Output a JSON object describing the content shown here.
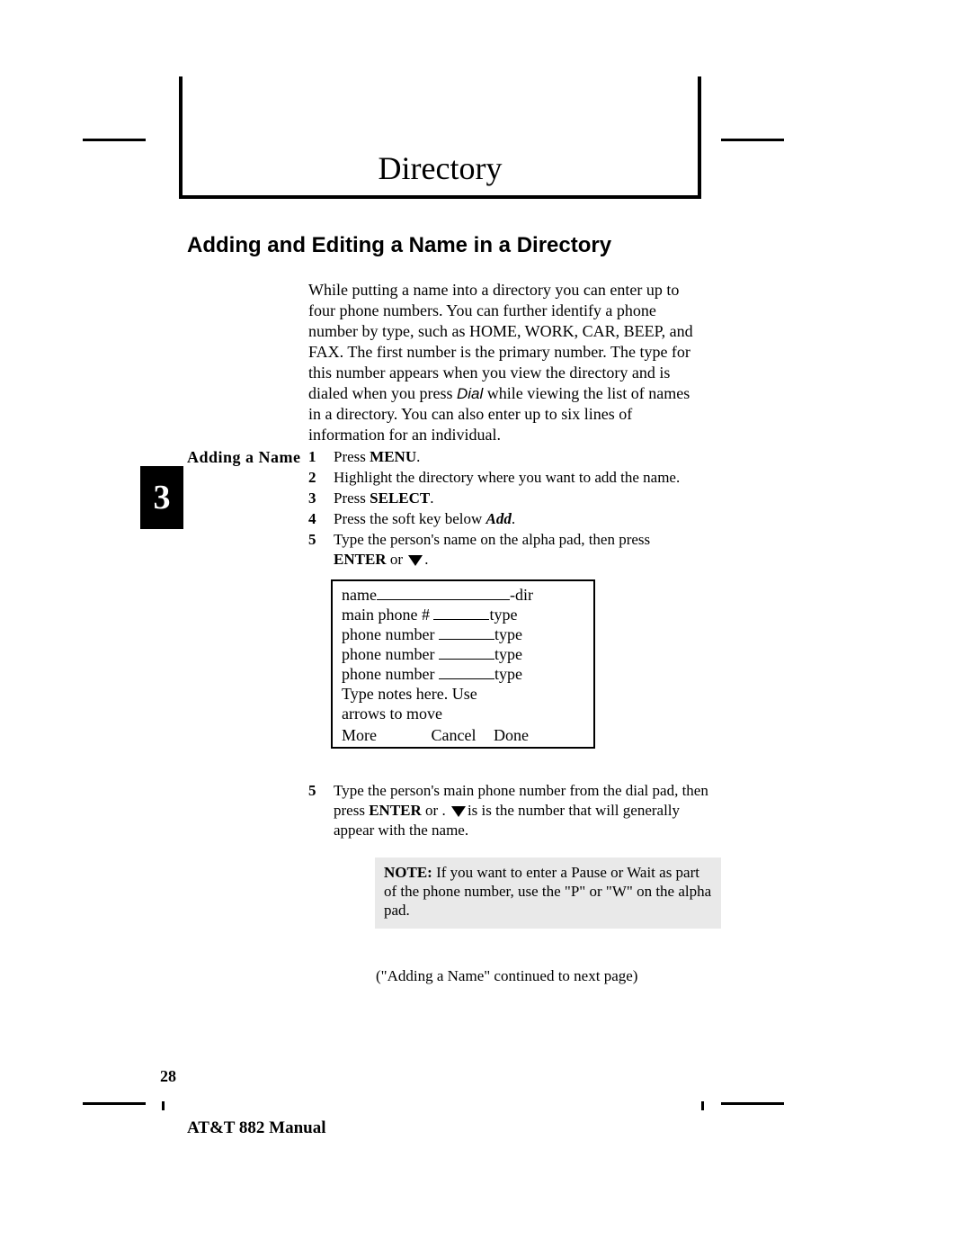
{
  "header_title": "Directory",
  "section_title": "Adding and Editing a Name in a Directory",
  "intro_pre": "While putting a name into a directory you can enter up to four phone numbers. You can further identify a phone number by type, such as HOME, WORK, CAR, BEEP, and FAX.  The first number is the primary number.  The type for this number appears when you view the directory and is dialed when you press ",
  "intro_dial": "Dial",
  "intro_post": " while viewing the list of names in a directory.   You can also enter up to six lines of information for an individual.",
  "side_label": "Adding  a  Name",
  "chapter_number": "3",
  "steps": [
    {
      "num": "1",
      "pre": "Press ",
      "bold": "MENU",
      "post": "."
    },
    {
      "num": "2",
      "pre": "Highlight  the  directory  where  you  want  to  add the  name.",
      "bold": "",
      "post": ""
    },
    {
      "num": "3",
      "pre": "Press ",
      "bold": "SELECT",
      "post": "."
    },
    {
      "num": "4",
      "pre": "Press  the  soft  key  below ",
      "bold_italic": "Add",
      "post": "."
    },
    {
      "num": "5",
      "pre": "Type  the  person's  name  on  the  alpha  pad, then  press ",
      "bold": "ENTER",
      "post": "  or  ",
      "arrow_after": true,
      "trailing": "."
    }
  ],
  "screen": {
    "line1_left": "name",
    "line1_right": "-dir",
    "line2_left": "main phone # ",
    "line2_right": "type",
    "line3_left": "phone number ",
    "line3_right": "type",
    "line4_left": "phone number ",
    "line4_right": "type",
    "line5_left": "phone number ",
    "line5_right": "type",
    "line6": "Type notes here.  Use",
    "line7": "arrows to move",
    "soft_more": " More",
    "soft_cancel": "Cancel",
    "soft_done": "Done"
  },
  "step5b": {
    "num": "5",
    "pre": "Type  the  person's  main  phone  number  from  the  dial  pad, then  press ",
    "bold": "ENTER",
    "mid": " or        .   ",
    "post": "is  is  the  number  that  will generally  appear  with  the  name."
  },
  "note": {
    "label": "NOTE:",
    "text": " If you want to enter a Pause or Wait as part of the phone number, use the \"P\" or \"W\" on the alpha pad."
  },
  "continued": "(\"Adding a Name\" continued to next page)",
  "page_number": "28",
  "manual_title": "AT&T 882 Manual"
}
